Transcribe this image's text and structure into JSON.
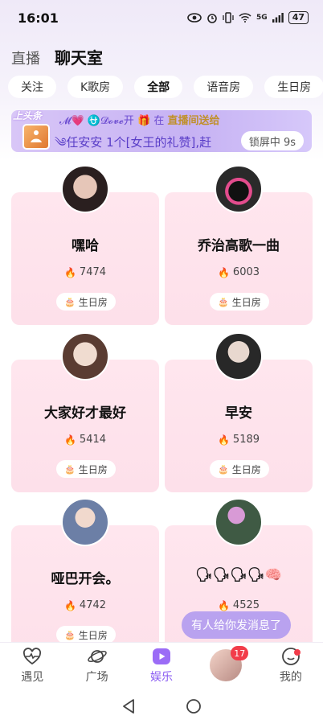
{
  "status_bar": {
    "time": "16:01",
    "battery": "47",
    "signal": "5G"
  },
  "header": {
    "tab_live": "直播",
    "tab_chat": "聊天室"
  },
  "tabs": [
    {
      "label": "关注"
    },
    {
      "label": "K歌房"
    },
    {
      "label": "全部",
      "selected": true
    },
    {
      "label": "语音房"
    },
    {
      "label": "生日房"
    }
  ],
  "banner": {
    "label": "上头条",
    "line1_deco": "𝓜💗 ⛎𝓓𝓸𝓿𝓮开",
    "line1_mid": "在",
    "line1_highlight": "直播间送给",
    "line2": "༄任安安 1个[女王的礼赞],赶",
    "lock_label": "锁屏中 9s"
  },
  "rooms": [
    {
      "name": "嘿哈",
      "heat": "7474",
      "tag": "生日房",
      "avatar_colors": [
        "#3a2a2a",
        "#d9b4a6"
      ]
    },
    {
      "name": "乔治高歌一曲",
      "heat": "6003",
      "tag": "生日房",
      "avatar_colors": [
        "#1a1a1a",
        "#e04a8a"
      ]
    },
    {
      "name": "大家好才最好",
      "heat": "5414",
      "tag": "生日房",
      "avatar_colors": [
        "#e8d2c5",
        "#6e4c40"
      ]
    },
    {
      "name": "早安",
      "heat": "5189",
      "tag": "生日房",
      "avatar_colors": [
        "#2b2b2b",
        "#d8c8c0"
      ]
    },
    {
      "name": "哑巴开会。",
      "heat": "4742",
      "tag": "生日房",
      "avatar_colors": [
        "#9ab3d6",
        "#4c5c80"
      ]
    },
    {
      "name": "🗣🗣🗣🗣🧠",
      "heat": "4525",
      "tag": "",
      "avatar_colors": [
        "#2d3c30",
        "#c88ac8"
      ]
    }
  ],
  "toast": "有人给你发消息了",
  "bottom_nav": [
    {
      "label": "遇见",
      "icon": "heartbeat-icon"
    },
    {
      "label": "广场",
      "icon": "planet-icon"
    },
    {
      "label": "娱乐",
      "icon": "play-icon",
      "active": true
    },
    {
      "label": "",
      "icon": "avatar",
      "badge": "17"
    },
    {
      "label": "我的",
      "icon": "face-icon",
      "dot": true
    }
  ],
  "colors": {
    "accent": "#8a5cf2",
    "card_bg": "#fde0ea",
    "fire": "#f2452b",
    "badge": "#f23c4a"
  }
}
